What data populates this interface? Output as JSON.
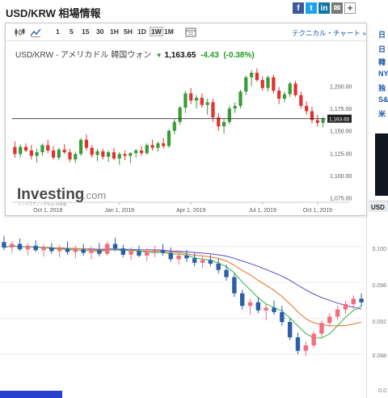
{
  "page": {
    "title": "USD/KRW 相場情報"
  },
  "share": {
    "facebook": "f",
    "twitter": "t",
    "linkedin": "in",
    "mail": "✉",
    "more": "+"
  },
  "toolbar": {
    "intervals": [
      "1",
      "5",
      "15",
      "30",
      "1H",
      "5H",
      "1D",
      "1W",
      "1M"
    ],
    "active_interval": "1W",
    "tech_link": "テクニカル・チャート »"
  },
  "quote": {
    "symbol": "USD/KRW - アメリカドル 韓国ウォン",
    "price": "1,163.65",
    "change": "-4.43",
    "change_pct": "(-0.38%)",
    "arrow": "▼"
  },
  "watermark": {
    "brand_main": "Investing",
    "brand_suffix": ".com",
    "tagline": "インベスティング.com 日本版"
  },
  "right_panel": {
    "items": [
      "日",
      "日",
      "韓",
      "NY",
      "独",
      "S&",
      "米"
    ],
    "tab_label": "USD"
  },
  "colors": {
    "up": "#3a9a3a",
    "down": "#e0332e",
    "bg_up": "#2d5ea8",
    "bg_down": "#f26d7d",
    "ma_purple": "#5b45c9",
    "ma_orange": "#e8701f",
    "ma_green": "#33b54a"
  },
  "chart_data": [
    {
      "type": "candlestick",
      "title": "USD/KRW - アメリカドル 韓国ウォン",
      "interval": "1W",
      "x_tick_labels": [
        "Oct 1, 2018",
        "Jan 1, 2019",
        "Apr 1, 2019",
        "Jul 1, 2019",
        "Oct 1, 2019"
      ],
      "y_tick_labels": [
        "1,075.00",
        "1,100.00",
        "1,125.00",
        "1,150.00",
        "1,175.00",
        "1,200.00"
      ],
      "ylim": [
        1070,
        1225
      ],
      "last_price_label": "1,163.65",
      "last_price": 1163.65,
      "series": [
        {
          "name": "USD/KRW",
          "ohlc": [
            [
              1132,
              1138,
              1120,
              1124
            ],
            [
              1124,
              1135,
              1120,
              1132
            ],
            [
              1132,
              1136,
              1126,
              1128
            ],
            [
              1128,
              1134,
              1118,
              1122
            ],
            [
              1122,
              1130,
              1114,
              1126
            ],
            [
              1126,
              1136,
              1122,
              1134
            ],
            [
              1134,
              1140,
              1125,
              1128
            ],
            [
              1128,
              1133,
              1118,
              1120
            ],
            [
              1120,
              1131,
              1117,
              1129
            ],
            [
              1129,
              1135,
              1124,
              1126
            ],
            [
              1126,
              1130,
              1115,
              1118
            ],
            [
              1118,
              1127,
              1114,
              1124
            ],
            [
              1124,
              1142,
              1122,
              1140
            ],
            [
              1140,
              1146,
              1128,
              1131
            ],
            [
              1131,
              1134,
              1120,
              1123
            ],
            [
              1123,
              1130,
              1116,
              1127
            ],
            [
              1127,
              1130,
              1118,
              1121
            ],
            [
              1121,
              1128,
              1115,
              1126
            ],
            [
              1126,
              1131,
              1117,
              1119
            ],
            [
              1119,
              1126,
              1112,
              1124
            ],
            [
              1124,
              1128,
              1117,
              1122
            ],
            [
              1122,
              1126,
              1114,
              1125
            ],
            [
              1125,
              1130,
              1120,
              1128
            ],
            [
              1128,
              1133,
              1122,
              1125
            ],
            [
              1125,
              1136,
              1123,
              1134
            ],
            [
              1134,
              1140,
              1128,
              1131
            ],
            [
              1131,
              1138,
              1127,
              1136
            ],
            [
              1136,
              1142,
              1130,
              1133
            ],
            [
              1133,
              1152,
              1131,
              1150
            ],
            [
              1150,
              1163,
              1146,
              1160
            ],
            [
              1160,
              1178,
              1157,
              1176
            ],
            [
              1176,
              1195,
              1170,
              1192
            ],
            [
              1192,
              1198,
              1180,
              1184
            ],
            [
              1184,
              1190,
              1175,
              1187
            ],
            [
              1187,
              1192,
              1176,
              1179
            ],
            [
              1179,
              1186,
              1168,
              1182
            ],
            [
              1182,
              1186,
              1160,
              1165
            ],
            [
              1165,
              1170,
              1150,
              1155
            ],
            [
              1155,
              1163,
              1147,
              1160
            ],
            [
              1160,
              1178,
              1157,
              1175
            ],
            [
              1175,
              1182,
              1170,
              1178
            ],
            [
              1178,
              1196,
              1175,
              1194
            ],
            [
              1194,
              1212,
              1190,
              1210
            ],
            [
              1210,
              1218,
              1200,
              1215
            ],
            [
              1215,
              1220,
              1205,
              1207
            ],
            [
              1207,
              1211,
              1195,
              1198
            ],
            [
              1198,
              1212,
              1194,
              1210
            ],
            [
              1210,
              1213,
              1192,
              1195
            ],
            [
              1195,
              1199,
              1180,
              1186
            ],
            [
              1186,
              1194,
              1182,
              1191
            ],
            [
              1191,
              1205,
              1188,
              1203
            ],
            [
              1203,
              1206,
              1188,
              1190
            ],
            [
              1190,
              1194,
              1175,
              1178
            ],
            [
              1178,
              1183,
              1168,
              1172
            ],
            [
              1172,
              1177,
              1158,
              1162
            ],
            [
              1162,
              1168,
              1155,
              1159
            ],
            [
              1159,
              1166,
              1154,
              1164
            ]
          ]
        }
      ]
    },
    {
      "type": "candlestick",
      "y_tick_labels": [
        "0.100",
        "0.096",
        "0.092",
        "0.088",
        "0.0"
      ],
      "ylim": [
        0.0835,
        0.1035
      ],
      "series": [
        {
          "name": "",
          "ohlc": [
            [
              0.1005,
              0.1012,
              0.0996,
              0.0999
            ],
            [
              0.0999,
              0.1006,
              0.0993,
              0.1003
            ],
            [
              0.1003,
              0.1009,
              0.0995,
              0.0997
            ],
            [
              0.0997,
              0.1004,
              0.099,
              0.1001
            ],
            [
              0.1001,
              0.1007,
              0.0994,
              0.0996
            ],
            [
              0.0996,
              0.1003,
              0.0989,
              0.0999
            ],
            [
              0.0999,
              0.1004,
              0.0992,
              0.0995
            ],
            [
              0.0995,
              0.1002,
              0.0988,
              0.0998
            ],
            [
              0.0998,
              0.1006,
              0.0991,
              0.0994
            ],
            [
              0.0994,
              0.1001,
              0.0987,
              0.0997
            ],
            [
              0.0997,
              0.1003,
              0.099,
              0.0993
            ],
            [
              0.0993,
              0.1,
              0.0986,
              0.0996
            ],
            [
              0.0996,
              0.1004,
              0.0989,
              0.0992
            ],
            [
              0.0992,
              0.1006,
              0.099,
              0.1003
            ],
            [
              0.1003,
              0.101,
              0.0995,
              0.0998
            ],
            [
              0.0998,
              0.1002,
              0.0988,
              0.0991
            ],
            [
              0.0991,
              0.0999,
              0.0985,
              0.0995
            ],
            [
              0.0995,
              0.1001,
              0.0988,
              0.099
            ],
            [
              0.099,
              0.0998,
              0.0984,
              0.0994
            ],
            [
              0.0994,
              0.1001,
              0.0988,
              0.0996
            ],
            [
              0.0996,
              0.1003,
              0.099,
              0.0993
            ],
            [
              0.0993,
              0.0999,
              0.0983,
              0.0986
            ],
            [
              0.0986,
              0.0994,
              0.098,
              0.099
            ],
            [
              0.099,
              0.0996,
              0.0983,
              0.0987
            ],
            [
              0.0987,
              0.0993,
              0.0978,
              0.0982
            ],
            [
              0.0982,
              0.099,
              0.0976,
              0.0985
            ],
            [
              0.0985,
              0.0991,
              0.0978,
              0.0981
            ],
            [
              0.0981,
              0.0987,
              0.097,
              0.0974
            ],
            [
              0.0974,
              0.098,
              0.0962,
              0.0966
            ],
            [
              0.0966,
              0.097,
              0.0944,
              0.0948
            ],
            [
              0.0948,
              0.0952,
              0.093,
              0.0934
            ],
            [
              0.0934,
              0.0942,
              0.0924,
              0.0938
            ],
            [
              0.0938,
              0.0944,
              0.0926,
              0.0929
            ],
            [
              0.0929,
              0.0936,
              0.0918,
              0.0932
            ],
            [
              0.0932,
              0.094,
              0.0924,
              0.0927
            ],
            [
              0.0927,
              0.0934,
              0.0912,
              0.0916
            ],
            [
              0.0916,
              0.092,
              0.0896,
              0.0899
            ],
            [
              0.0899,
              0.0904,
              0.088,
              0.0884
            ],
            [
              0.0884,
              0.0894,
              0.0878,
              0.089
            ],
            [
              0.089,
              0.0906,
              0.0887,
              0.0903
            ],
            [
              0.0903,
              0.0918,
              0.0899,
              0.0915
            ],
            [
              0.0915,
              0.0926,
              0.0911,
              0.0922
            ],
            [
              0.0922,
              0.0934,
              0.0918,
              0.093
            ],
            [
              0.093,
              0.094,
              0.0925,
              0.0936
            ],
            [
              0.0936,
              0.0946,
              0.0931,
              0.0942
            ],
            [
              0.0942,
              0.0948,
              0.0933,
              0.0938
            ]
          ]
        }
      ]
    }
  ]
}
